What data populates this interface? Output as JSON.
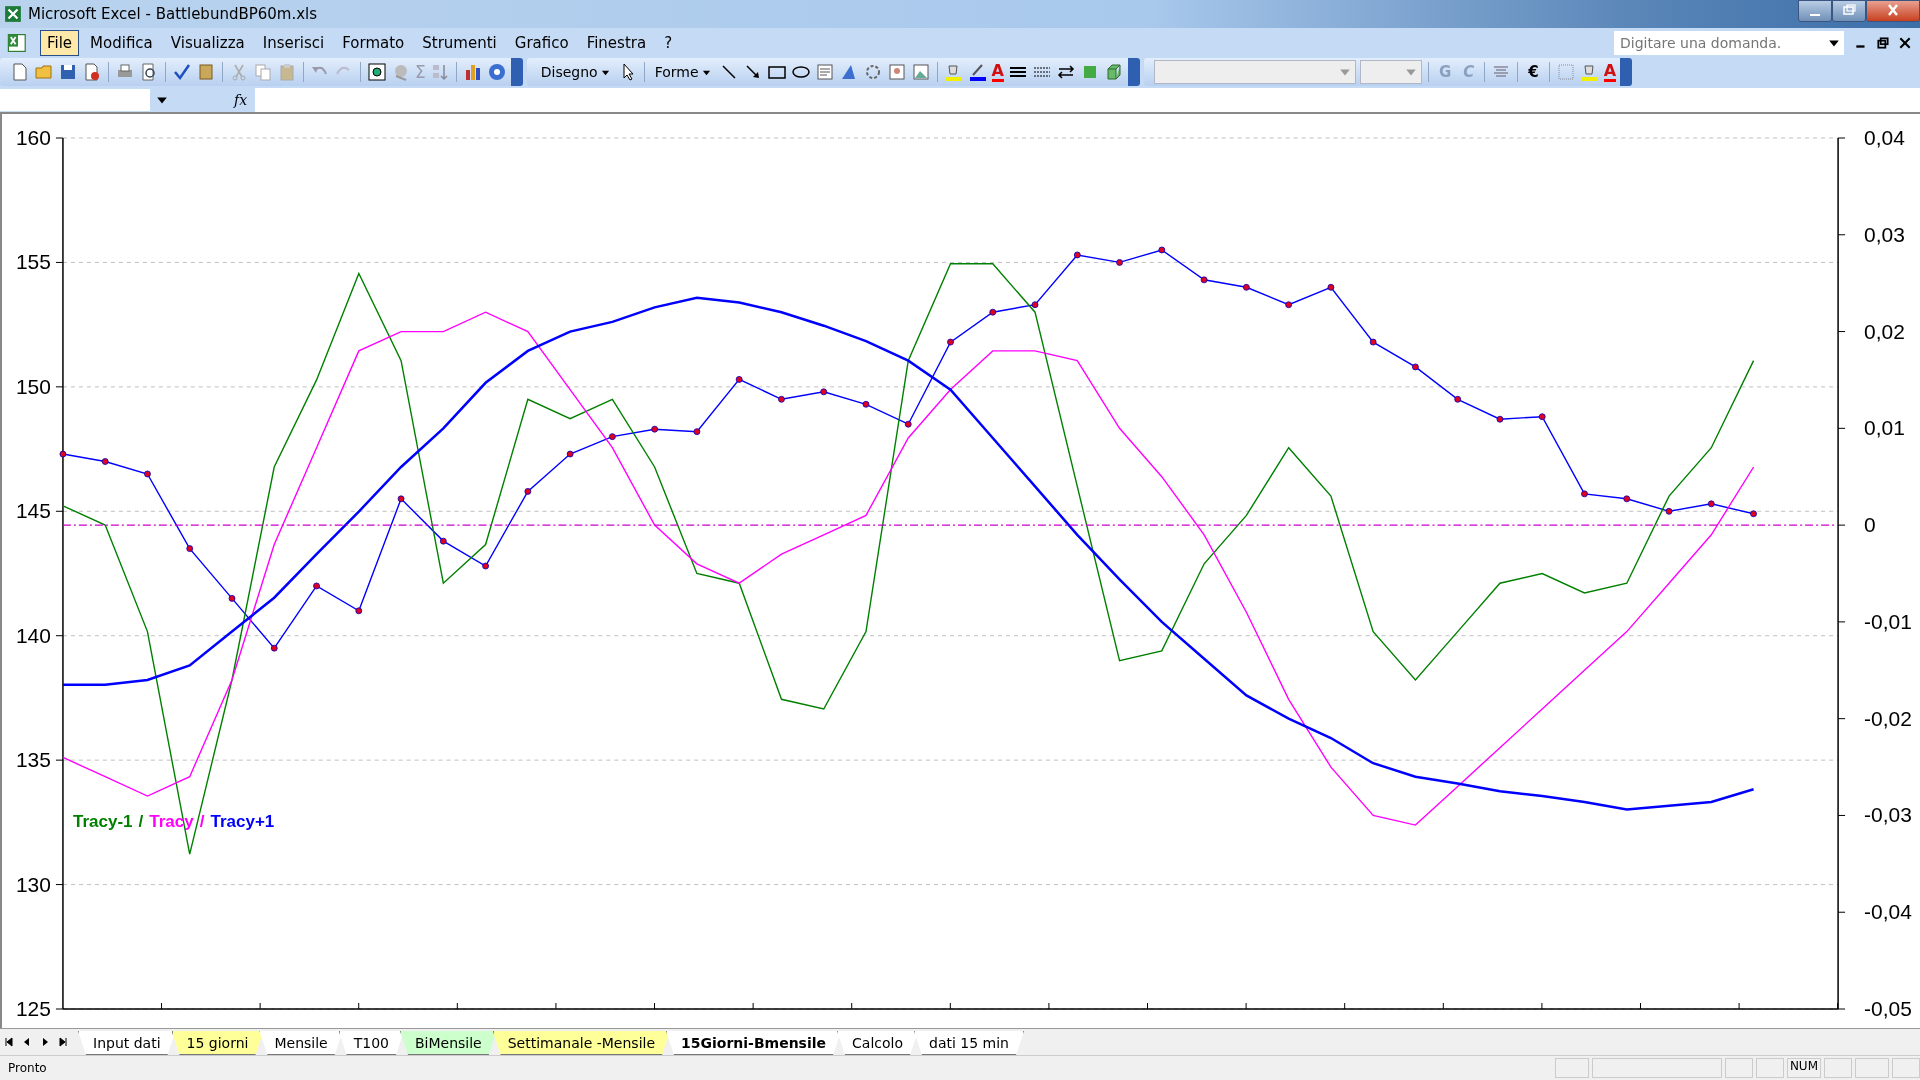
{
  "window": {
    "title": "Microsoft Excel - BattlebundBP60m.xls"
  },
  "menu_bar": {
    "items": [
      {
        "label": "File",
        "selected": true
      },
      {
        "label": "Modifica",
        "selected": false
      },
      {
        "label": "Visualizza",
        "selected": false
      },
      {
        "label": "Inserisci",
        "selected": false
      },
      {
        "label": "Formato",
        "selected": false
      },
      {
        "label": "Strumenti",
        "selected": false
      },
      {
        "label": "Grafico",
        "selected": false
      },
      {
        "label": "Finestra",
        "selected": false
      },
      {
        "label": "?",
        "selected": false
      }
    ],
    "help_search": {
      "placeholder": "Digitare una domanda."
    }
  },
  "standard_toolbar": {
    "sum_symbol": "Σ"
  },
  "drawing_toolbar": {
    "draw_menu": "Disegno",
    "shapes_menu": "Forme",
    "font_color_glyph": "A"
  },
  "formatting_toolbar": {
    "bold": "G",
    "italic": "C",
    "currency": "€",
    "font_color_glyph": "A"
  },
  "formula_bar": {
    "function_label": "fx"
  },
  "price_chart": {
    "chart_data": {
      "type": "line",
      "grid": true,
      "ylim": [
        125,
        160
      ],
      "yticks": [
        125,
        130,
        135,
        140,
        145,
        150,
        155,
        160
      ],
      "categories": [
        null,
        null,
        null,
        null,
        null,
        null,
        null,
        null,
        null,
        null,
        null,
        null,
        null,
        null,
        null,
        null,
        null,
        null,
        null,
        null,
        null,
        null,
        null,
        null,
        null,
        null,
        null,
        null,
        null,
        null,
        null,
        null,
        null,
        null,
        null,
        null,
        null,
        null,
        null,
        null,
        null,
        null,
        null
      ],
      "series": [
        {
          "color": "#0000ff",
          "marker": "circle",
          "values": [
            147.3,
            147.0,
            146.5,
            143.5,
            141.5,
            139.5,
            142.0,
            141.0,
            145.5,
            143.8,
            142.8,
            145.8,
            147.3,
            148.0,
            148.3,
            148.2,
            150.3,
            149.5,
            149.8,
            149.3,
            148.5,
            151.8,
            153.0,
            153.3,
            155.3,
            155.0,
            155.5,
            154.3,
            154.0,
            153.3,
            154.0,
            151.8,
            150.8,
            149.5,
            148.7,
            148.8,
            145.7,
            145.5,
            145.0,
            145.3,
            144.9,
            null,
            null
          ]
        }
      ]
    }
  },
  "tracy_chart": {
    "legend_separators": [
      "/",
      "/"
    ],
    "chart_data": {
      "type": "line",
      "ylim": [
        -0.05,
        0.04
      ],
      "yticks": [
        {
          "value": 0.04,
          "label": "0,04"
        },
        {
          "value": 0.03,
          "label": "0,03"
        },
        {
          "value": 0.02,
          "label": "0,02"
        },
        {
          "value": 0.01,
          "label": "0,01"
        },
        {
          "value": 0,
          "label": "0"
        },
        {
          "value": -0.01,
          "label": "-0,01"
        },
        {
          "value": -0.02,
          "label": "-0,02"
        },
        {
          "value": -0.03,
          "label": "-0,03"
        },
        {
          "value": -0.04,
          "label": "-0,04"
        },
        {
          "value": -0.05,
          "label": "-0,05"
        }
      ],
      "categories": [
        null,
        null,
        null,
        null,
        null,
        null,
        null,
        null,
        null,
        null,
        null,
        null,
        null,
        null,
        null,
        null,
        null,
        null,
        null,
        null,
        null,
        null,
        null,
        null,
        null,
        null,
        null,
        null,
        null,
        null,
        null,
        null,
        null,
        null,
        null,
        null,
        null,
        null,
        null,
        null,
        null,
        null,
        null
      ],
      "series": [
        {
          "name": "Tracy-1",
          "color": "#008000",
          "values": [
            0.002,
            0.0,
            -0.011,
            -0.034,
            -0.016,
            0.006,
            0.015,
            0.026,
            0.017,
            -0.006,
            -0.002,
            0.013,
            0.011,
            0.013,
            0.006,
            -0.005,
            -0.006,
            -0.018,
            -0.019,
            -0.011,
            0.017,
            0.027,
            0.027,
            0.022,
            0.004,
            -0.014,
            -0.013,
            -0.004,
            0.001,
            0.008,
            0.003,
            -0.011,
            -0.016,
            -0.011,
            -0.006,
            -0.005,
            -0.007,
            -0.006,
            0.003,
            0.008,
            0.017,
            null,
            null
          ]
        },
        {
          "name": "Tracy",
          "color": "#ff00ff",
          "values": [
            -0.024,
            -0.026,
            -0.028,
            -0.026,
            -0.016,
            -0.002,
            0.008,
            0.018,
            0.02,
            0.02,
            0.022,
            0.02,
            0.014,
            0.008,
            0.0,
            -0.004,
            -0.006,
            -0.003,
            -0.001,
            0.001,
            0.009,
            0.014,
            0.018,
            0.018,
            0.017,
            0.01,
            0.005,
            -0.001,
            -0.009,
            -0.018,
            -0.025,
            -0.03,
            -0.031,
            -0.027,
            -0.023,
            -0.019,
            -0.015,
            -0.011,
            -0.006,
            -0.001,
            0.006,
            null,
            null
          ]
        },
        {
          "name": "Tracy+1",
          "color": "#0000ff",
          "values": [
            -0.0165,
            -0.0165,
            -0.016,
            -0.0145,
            -0.011,
            -0.0075,
            -0.003,
            0.0014,
            0.006,
            0.01,
            0.0147,
            0.018,
            0.02,
            0.021,
            0.0225,
            0.0235,
            0.023,
            0.022,
            0.0206,
            0.019,
            0.017,
            0.014,
            0.009,
            0.004,
            -0.001,
            -0.0056,
            -0.01,
            -0.0138,
            -0.0176,
            -0.02,
            -0.022,
            -0.0246,
            -0.026,
            -0.0267,
            -0.0275,
            -0.028,
            -0.0286,
            -0.0294,
            -0.029,
            -0.0286,
            -0.0273,
            null,
            null
          ]
        },
        {
          "color": "#cc00cc",
          "line_style": "dashdot",
          "values": [
            0,
            0,
            0,
            0,
            0,
            0,
            0,
            0,
            0,
            0,
            0,
            0,
            0,
            0,
            0,
            0,
            0,
            0,
            0,
            0,
            0,
            0,
            0,
            0,
            0,
            0,
            0,
            0,
            0,
            0,
            0,
            0,
            0,
            0,
            0,
            0,
            0,
            0,
            0,
            0,
            0,
            0,
            0
          ]
        }
      ]
    }
  },
  "sheet_tabs": [
    {
      "label": "Input dati",
      "selected": false,
      "color": "#ffffff"
    },
    {
      "label": "15 giorni",
      "selected": false,
      "color": "#ffff99"
    },
    {
      "label": "Mensile",
      "selected": false,
      "color": "#ffffff"
    },
    {
      "label": "T100",
      "selected": false,
      "color": "#ffffff"
    },
    {
      "label": "BiMensile",
      "selected": false,
      "color": "#ccffcc"
    },
    {
      "label": "Settimanale -Mensile",
      "selected": false,
      "color": "#ffff99"
    },
    {
      "label": "15Giorni-Bmensile",
      "selected": true,
      "color": "#ffffff"
    },
    {
      "label": "Calcolo",
      "selected": false,
      "color": "#ffffff"
    },
    {
      "label": "dati 15 min",
      "selected": false,
      "color": "#ffffff"
    }
  ],
  "status_bar": {
    "status": "Pronto",
    "indicators": [
      "NUM"
    ]
  }
}
